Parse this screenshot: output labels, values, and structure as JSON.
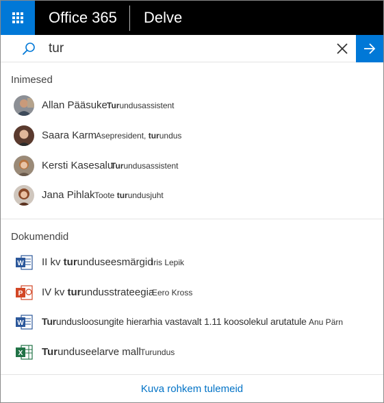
{
  "header": {
    "brand": "Office 365",
    "app_name": "Delve"
  },
  "search": {
    "query": "tur",
    "placeholder": ""
  },
  "people": {
    "label": "Inimesed",
    "items": [
      {
        "name": "Allan Pääsuke",
        "meta_bold": "Tur",
        "meta_rest": "undusassistent",
        "meta_prefix": ""
      },
      {
        "name": "Saara Karm",
        "meta_prefix": "Asepresident, ",
        "meta_bold": "tur",
        "meta_rest": "undus"
      },
      {
        "name": "Kersti Kasesalu",
        "meta_prefix": "",
        "meta_bold": "Tur",
        "meta_rest": "undusassistent"
      },
      {
        "name": "Jana Pihlak",
        "meta_prefix": "Toote ",
        "meta_bold": "tur",
        "meta_rest": "undusjuht"
      }
    ]
  },
  "documents": {
    "label": "Dokumendid",
    "items": [
      {
        "type": "word",
        "title_prefix": "II kv ",
        "title_bold": "tur",
        "title_rest": "unduseesmärgid",
        "author": "Iris Lepik"
      },
      {
        "type": "powerpoint",
        "title_prefix": "IV kv ",
        "title_bold": "tur",
        "title_rest": "undusstrateegia",
        "author": "Eero Kross"
      },
      {
        "type": "word",
        "title_prefix": "",
        "title_bold": "Tur",
        "title_rest": "undusloosungite hierarhia vastavalt 1.11 koosolekul arutatule",
        "author": "Anu Pärn"
      },
      {
        "type": "excel",
        "title_prefix": "",
        "title_bold": "Tur",
        "title_rest": "unduseelarve mall",
        "author": "Turundus"
      }
    ]
  },
  "footer": {
    "more_label": "Kuva rohkem tulemeid"
  },
  "colors": {
    "accent": "#0078d7",
    "word": "#2b579a",
    "powerpoint": "#d24726",
    "excel": "#217346",
    "link": "#0072c6"
  }
}
